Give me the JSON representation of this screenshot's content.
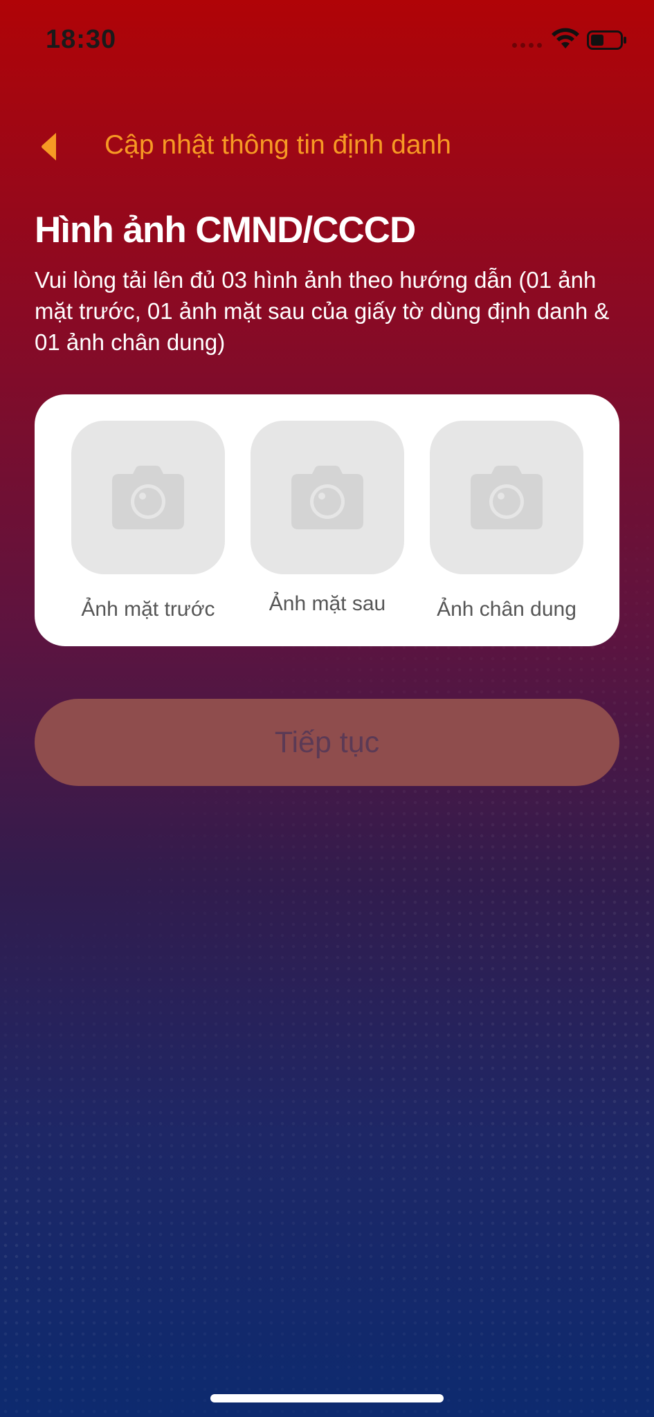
{
  "status_bar": {
    "time": "18:30"
  },
  "nav": {
    "title": "Cập nhật thông tin định danh",
    "back_icon": "chevron-left-icon"
  },
  "page": {
    "title": "Hình ảnh CMND/CCCD",
    "instructions": "Vui lòng tải lên đủ 03 hình ảnh theo hướng dẫn (01 ảnh mặt trước, 01 ảnh mặt sau của giấy tờ dùng định danh & 01 ảnh chân dung)"
  },
  "photos": [
    {
      "label": "Ảnh mặt trước",
      "icon": "camera-icon"
    },
    {
      "label": "Ảnh mặt sau",
      "icon": "camera-icon"
    },
    {
      "label": "Ảnh chân dung",
      "icon": "camera-icon"
    }
  ],
  "actions": {
    "continue_label": "Tiếp tục"
  },
  "colors": {
    "accent": "#f79a24",
    "background_top": "#b00407",
    "background_bottom": "#0d2a6f",
    "button_disabled": "#8f4d4d"
  }
}
